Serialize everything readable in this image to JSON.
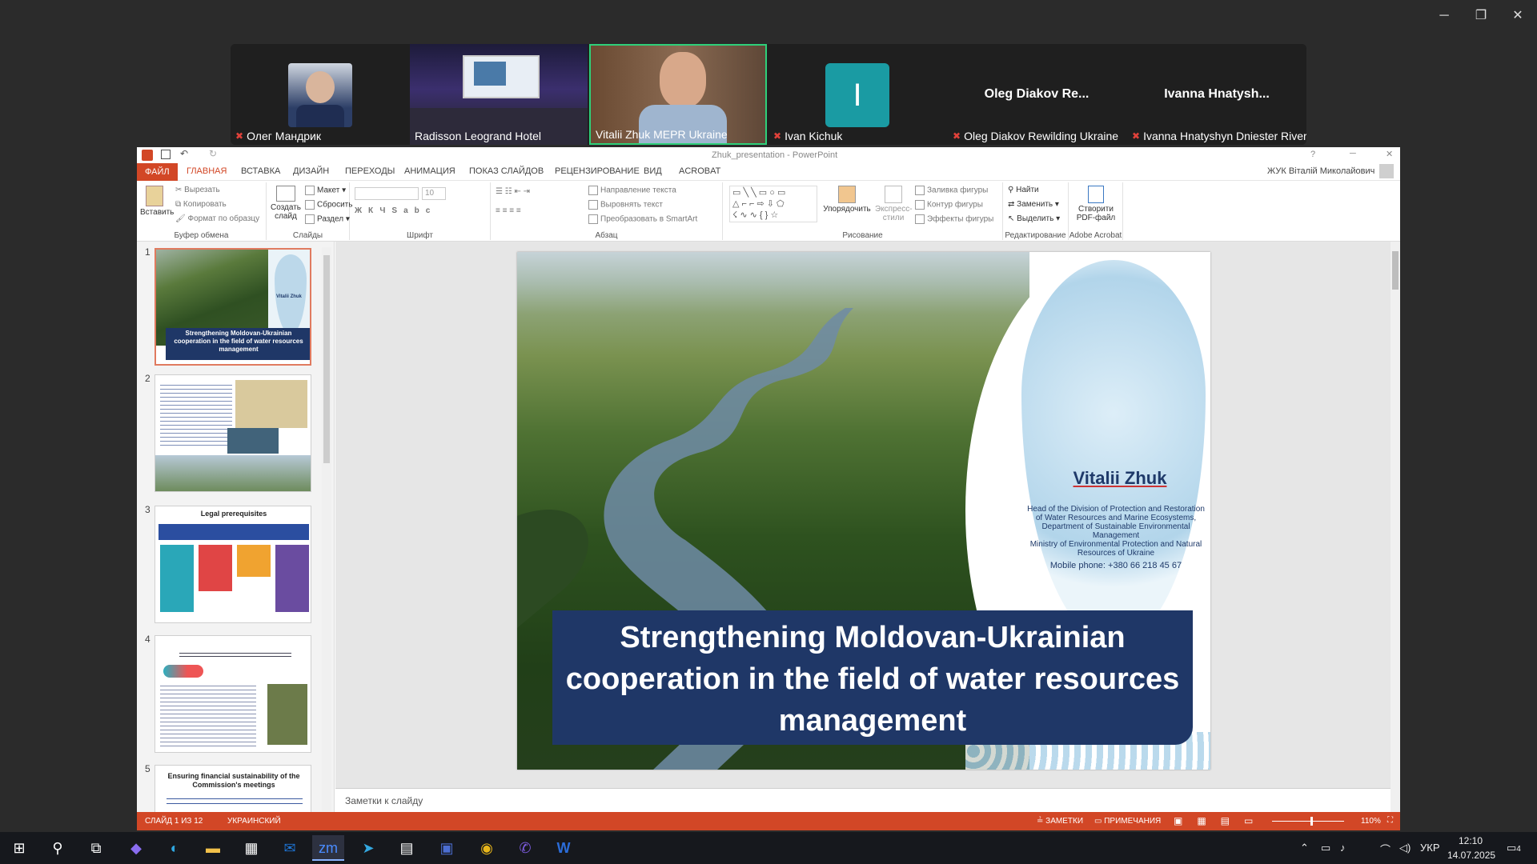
{
  "window": {
    "minimize": "─",
    "restore": "❐",
    "close": "✕"
  },
  "participants": [
    {
      "name": "Олег Мандрик",
      "muted": true
    },
    {
      "name": "Radisson Leogrand Hotel",
      "muted": false
    },
    {
      "name": "Vitalii Zhuk MEPR Ukraine",
      "muted": false,
      "active": true
    },
    {
      "name": "Ivan Kichuk",
      "muted": true,
      "avatar_letter": "I",
      "avatar_color": "#1a9ba3"
    },
    {
      "name": "Oleg Diakov Rewilding Ukraine",
      "muted": true,
      "big_label": "Oleg  Diakov  Re..."
    },
    {
      "name": "Ivanna Hnatyshyn Dniester River ...",
      "muted": true,
      "big_label": "Ivanna  Hnatysh..."
    }
  ],
  "ppt": {
    "title": "Zhuk_presentation - PowerPoint",
    "user": "ЖУК Віталій Миколайович",
    "tabs": [
      "ФАЙЛ",
      "ГЛАВНАЯ",
      "ВСТАВКА",
      "ДИЗАЙН",
      "ПЕРЕХОДЫ",
      "АНИМАЦИЯ",
      "ПОКАЗ СЛАЙДОВ",
      "РЕЦЕНЗИРОВАНИЕ",
      "ВИД",
      "ACROBAT"
    ],
    "ribbon": {
      "paste": "Вставить",
      "cut": "Вырезать",
      "copy": "Копировать",
      "format_painter": "Формат по образцу",
      "clipboard_group": "Буфер обмена",
      "new_slide": "Создать слайд",
      "layout": "Макет",
      "reset": "Сбросить",
      "section": "Раздел",
      "slides_group": "Слайды",
      "font_size": "10",
      "font_group": "Шрифт",
      "text_direction": "Направление текста",
      "align_text": "Выровнять текст",
      "smartart": "Преобразовать в SmartArt",
      "paragraph_group": "Абзац",
      "arrange": "Упорядочить",
      "quick_styles": "Экспресс-стили",
      "shape_fill": "Заливка фигуры",
      "shape_outline": "Контур фигуры",
      "shape_effects": "Эффекты фигуры",
      "drawing_group": "Рисование",
      "find": "Найти",
      "replace": "Заменить",
      "select": "Выделить",
      "editing_group": "Редактирование",
      "create_pdf": "Створити PDF-файл",
      "acrobat_group": "Adobe Acrobat"
    },
    "thumbs": [
      {
        "num": "1",
        "text": "Strengthening Moldovan-Ukrainian cooperation in the field of water resources management",
        "name": "Vitalii Zhuk"
      },
      {
        "num": "2"
      },
      {
        "num": "3",
        "title": "Legal prerequisites"
      },
      {
        "num": "4"
      },
      {
        "num": "5",
        "title": "Ensuring financial sustainability of the Commission's meetings"
      }
    ],
    "slide": {
      "name": "Vitalii Zhuk",
      "position": "Head of the Division of Protection and Restoration of Water Resources and Marine Ecosystems, Department of Sustainable Environmental Management",
      "ministry": "Ministry of Environmental Protection and Natural Resources of Ukraine",
      "phone": "Mobile phone: +380 66 218 45 67",
      "title": "Strengthening Moldovan-Ukrainian cooperation in the field of water resources management"
    },
    "notes_placeholder": "Заметки к слайду",
    "status": {
      "slide": "СЛАЙД 1 ИЗ 12",
      "lang": "УКРАИНСКИЙ",
      "notes": "ЗАМЕТКИ",
      "comments": "ПРИМЕЧАНИЯ",
      "zoom": "110%"
    }
  },
  "taskbar": {
    "lang": "УКР",
    "time": "12:10",
    "date": "14.07.2025",
    "notif": "4"
  }
}
